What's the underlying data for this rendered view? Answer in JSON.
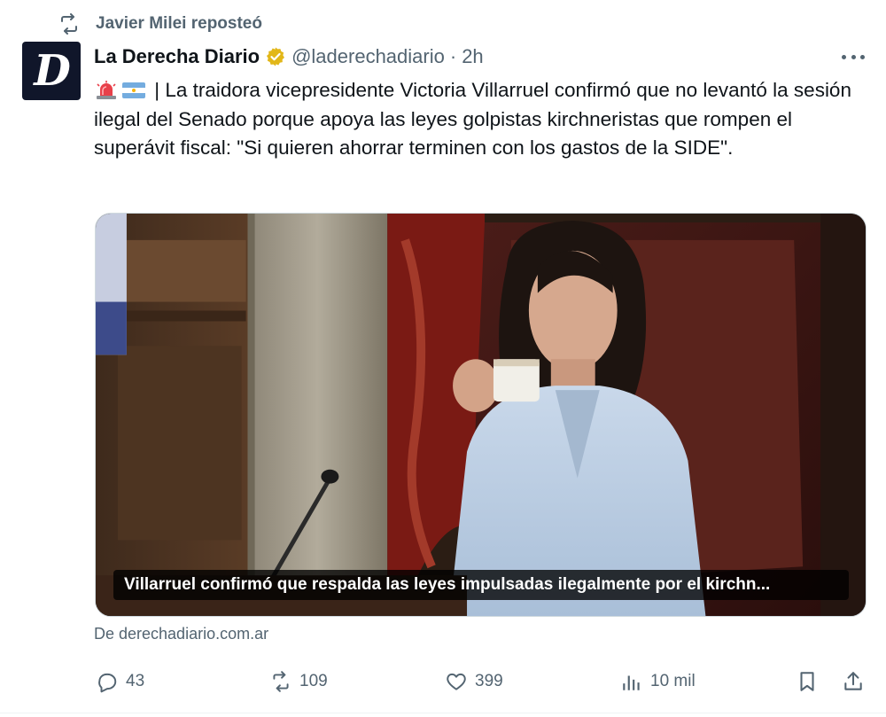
{
  "repost": {
    "label": "Javier Milei reposteó",
    "icon": "repost-icon"
  },
  "author": {
    "avatar_letter": "D",
    "name": "La Derecha Diario",
    "verified_badge": "verified-gold-badge",
    "handle": "@laderechadiario",
    "separator": "·",
    "time": "2h"
  },
  "tweet": {
    "emojis": [
      "rotating-light-emoji",
      "argentina-flag-emoji"
    ],
    "text": "| La traidora vicepresidente Victoria Villarruel confirmó que no levantó la sesión ilegal del Senado porque apoya las leyes golpistas kirchneristas que rompen el superávit fiscal: \"Si quieren ahorrar terminen con los gastos de la SIDE\"."
  },
  "media": {
    "caption": "Villarruel confirmó que respalda las leyes impulsadas ilegalmente por el kirchn...",
    "source": "De derechadiario.com.ar"
  },
  "actions": {
    "reply": {
      "icon": "reply-icon",
      "count": "43"
    },
    "repost": {
      "icon": "repost-icon",
      "count": "109"
    },
    "like": {
      "icon": "heart-icon",
      "count": "399"
    },
    "views": {
      "icon": "views-chart-icon",
      "count": "10 mil"
    },
    "bookmark": {
      "icon": "bookmark-icon"
    },
    "share": {
      "icon": "share-icon"
    }
  },
  "colors": {
    "text_primary": "#0f1419",
    "text_secondary": "#536471",
    "verified_gold": "#e2b719",
    "caption_bg": "#000000"
  }
}
